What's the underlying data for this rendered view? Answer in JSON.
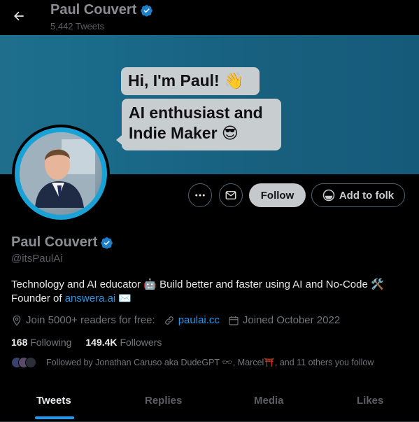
{
  "header": {
    "display_name": "Paul Couvert",
    "tweet_count": "5,442 Tweets"
  },
  "banner": {
    "line1": "Hi, I'm Paul! 👋",
    "line2a": "AI enthusiast and",
    "line2b": "Indie Maker 😎"
  },
  "actions": {
    "follow_label": "Follow",
    "folk_label": "Add to folk"
  },
  "profile": {
    "name": "Paul Couvert",
    "handle": "@itsPaulAi",
    "bio_line1": "Technology and AI educator 🤖 Build better and faster using AI and No-Code 🛠️",
    "bio_line2_prefix": "Founder of ",
    "bio_link": "answera.ai",
    "bio_line2_suffix": " ✉️",
    "location": "Join 5000+ readers for free:",
    "website": "paulai.cc",
    "joined": "Joined October 2022",
    "following_count": "168",
    "following_label": "Following",
    "followers_count": "149.4K",
    "followers_label": "Followers",
    "followed_by": "Followed by Jonathan Caruso aka DudeGPT 🕶️, Marcel⛩️, and 11 others you follow"
  },
  "tabs": [
    {
      "label": "Tweets",
      "active": true
    },
    {
      "label": "Replies",
      "active": false
    },
    {
      "label": "Media",
      "active": false
    },
    {
      "label": "Likes",
      "active": false
    }
  ],
  "colors": {
    "accent": "#1d9bf0",
    "background": "#000000",
    "banner": "#1a6a8a"
  },
  "icons": [
    "back-arrow-icon",
    "verified-badge-icon",
    "more-icon",
    "message-icon",
    "folk-icon",
    "location-icon",
    "link-icon",
    "calendar-icon"
  ]
}
